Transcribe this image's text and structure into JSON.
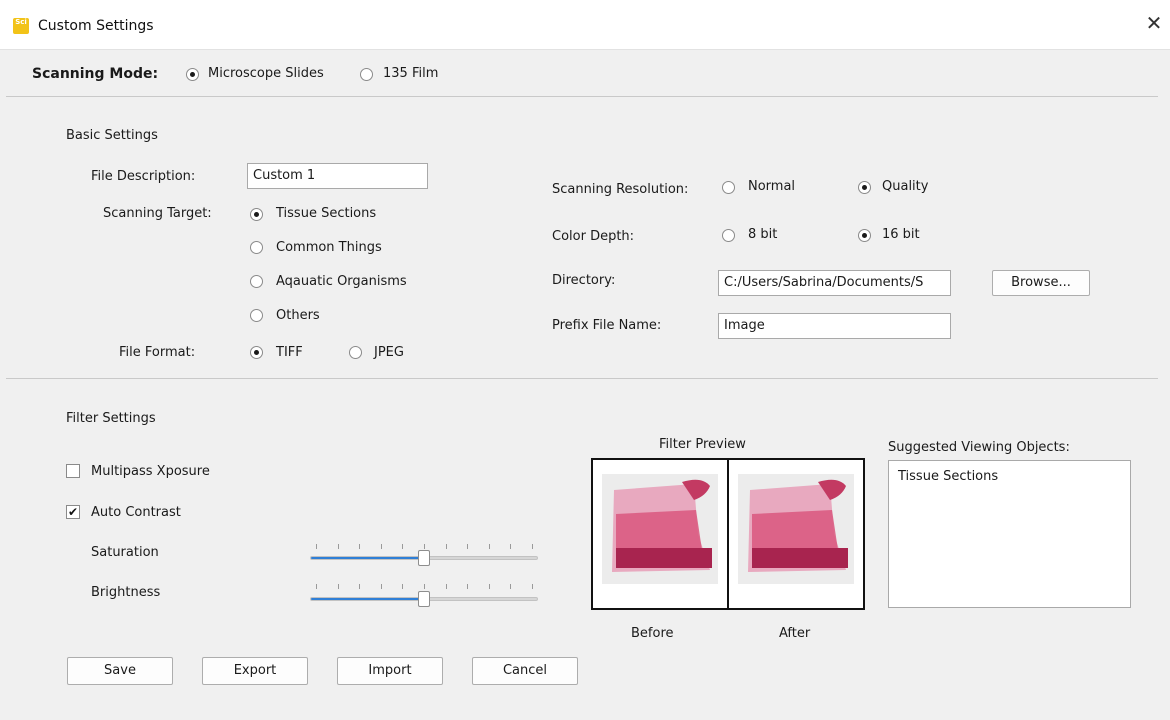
{
  "window": {
    "title": "Custom Settings",
    "close_glyph": "✕",
    "app_icon_text": "Sci"
  },
  "scanning_mode": {
    "label": "Scanning Mode:",
    "options": [
      "Microscope Slides",
      "135 Film"
    ],
    "selected": "Microscope Slides"
  },
  "basic": {
    "heading": "Basic Settings",
    "file_description_label": "File Description:",
    "file_description_value": "Custom 1",
    "scanning_target_label": "Scanning Target:",
    "scanning_target_options": [
      "Tissue Sections",
      "Common Things",
      "Aqauatic Organisms",
      "Others"
    ],
    "scanning_target_selected": "Tissue Sections",
    "file_format_label": "File Format:",
    "file_format_options": [
      "TIFF",
      "JPEG"
    ],
    "file_format_selected": "TIFF",
    "resolution_label": "Scanning Resolution:",
    "resolution_options": [
      "Normal",
      "Quality"
    ],
    "resolution_selected": "Quality",
    "color_depth_label": "Color Depth:",
    "color_depth_options": [
      "8 bit",
      "16 bit"
    ],
    "color_depth_selected": "16 bit",
    "directory_label": "Directory:",
    "directory_value": "C:/Users/Sabrina/Documents/S",
    "browse_label": "Browse...",
    "prefix_label": "Prefix File Name:",
    "prefix_value": "Image"
  },
  "filter": {
    "heading": "Filter Settings",
    "multipass_label": "Multipass Xposure",
    "multipass_checked": false,
    "auto_contrast_label": "Auto Contrast",
    "auto_contrast_checked": true,
    "saturation_label": "Saturation",
    "saturation_value": 0.5,
    "brightness_label": "Brightness",
    "brightness_value": 0.5,
    "preview_title": "Filter Preview",
    "before_label": "Before",
    "after_label": "After",
    "suggested_title": "Suggested Viewing Objects:",
    "suggested_items": [
      "Tissue Sections"
    ]
  },
  "buttons": {
    "save": "Save",
    "export": "Export",
    "import": "Import",
    "cancel": "Cancel"
  },
  "icons": {
    "app": "app-icon",
    "close": "close-icon",
    "check": "check-icon"
  },
  "colors": {
    "slider_fill": "#2f7fd6",
    "tissue": "#d9577e",
    "app_icon": "#f2c318"
  }
}
